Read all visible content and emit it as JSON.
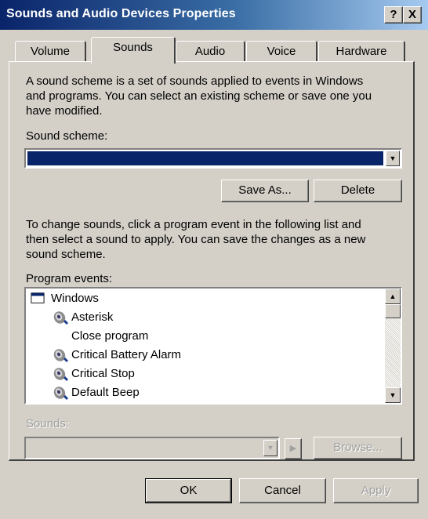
{
  "window": {
    "title": "Sounds and Audio Devices Properties",
    "help_label": "?",
    "close_label": "X"
  },
  "tabs": [
    {
      "label": "Volume",
      "active": false
    },
    {
      "label": "Sounds",
      "active": true
    },
    {
      "label": "Audio",
      "active": false
    },
    {
      "label": "Voice",
      "active": false
    },
    {
      "label": "Hardware",
      "active": false
    }
  ],
  "sounds_tab": {
    "description_lines": [
      "A sound scheme is a set of sounds applied to events in Windows",
      "and programs. You can select an existing scheme or save one you",
      "have modified."
    ],
    "scheme_label": "Sound scheme:",
    "scheme_value": "",
    "save_as_label": "Save As...",
    "delete_label": "Delete",
    "instructions_lines": [
      "To change sounds, click a program event in the following list and",
      "then select a sound to apply. You can save the changes as a new",
      "sound scheme."
    ],
    "events_label": "Program events:",
    "events": [
      {
        "label": "Windows",
        "icon": "window-icon",
        "level": 0
      },
      {
        "label": "Asterisk",
        "icon": "speaker-icon",
        "level": 1
      },
      {
        "label": "Close program",
        "icon": "",
        "level": 1
      },
      {
        "label": "Critical Battery Alarm",
        "icon": "speaker-icon",
        "level": 1
      },
      {
        "label": "Critical Stop",
        "icon": "speaker-icon",
        "level": 1
      },
      {
        "label": "Default Beep",
        "icon": "speaker-icon",
        "level": 1
      }
    ],
    "sounds_label": "Sounds:",
    "sounds_value": "",
    "browse_label": "Browse..."
  },
  "footer": {
    "ok_label": "OK",
    "cancel_label": "Cancel",
    "apply_label": "Apply"
  },
  "colors": {
    "face": "#d4d0c8",
    "title_start": "#0a246a",
    "title_end": "#a6caf0",
    "selection": "#0a246a"
  }
}
